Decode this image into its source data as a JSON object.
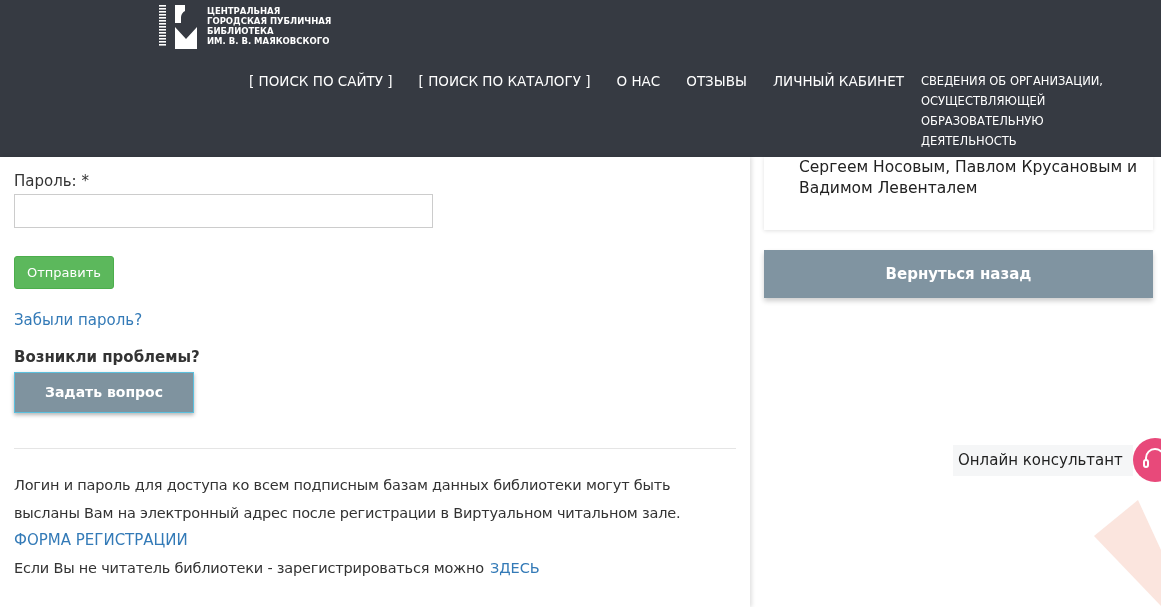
{
  "header": {
    "logo_lines": [
      "ЦЕНТРАЛЬНАЯ",
      "ГОРОДСКАЯ ПУБЛИЧНАЯ",
      "БИБЛИОТЕКА",
      "ИМ. В. В. МАЯКОВСКОГО"
    ],
    "nav": [
      {
        "label": "[ ПОИСК ПО САЙТУ ]",
        "kind": "big"
      },
      {
        "label": "[ ПОИСК ПО КАТАЛОГУ ]",
        "kind": "big"
      },
      {
        "label": "О НАС",
        "kind": "big"
      },
      {
        "label": "ОТЗЫВЫ",
        "kind": "big"
      },
      {
        "label": "ЛИЧНЫЙ КАБИНЕТ",
        "kind": "big"
      },
      {
        "label": "СВЕДЕНИЯ ОБ ОРГАНИЗАЦИИ, ОСУЩЕСТВЛЯЮЩЕЙ ОБРАЗОВАТЕЛЬНУЮ ДЕЯТЕЛЬНОСТЬ",
        "kind": "small"
      }
    ]
  },
  "form": {
    "password_label": "Пароль: *",
    "submit": "Отправить",
    "forgot": "Забыли пароль?",
    "problems": "Возникли проблемы?",
    "ask": "Задать вопрос"
  },
  "info": {
    "text": "Логин и пароль для доступа ко всем подписным базам данных библиотеки могут быть высланы Вам на электронный адрес после регистрации в Виртуальном читальном зале.",
    "registration_link": "ФОРМА РЕГИСТРАЦИИ",
    "not_reader_text": "Если Вы не читатель библиотеки - зарегистрироваться можно",
    "here_link": "ЗДЕСЬ"
  },
  "sidebar": {
    "event_text": "Сергеем Носовым, Павлом Крусановым и Вадимом Левенталем",
    "back": "Вернуться назад"
  },
  "consultant": {
    "label": "Онлайн консультант"
  }
}
